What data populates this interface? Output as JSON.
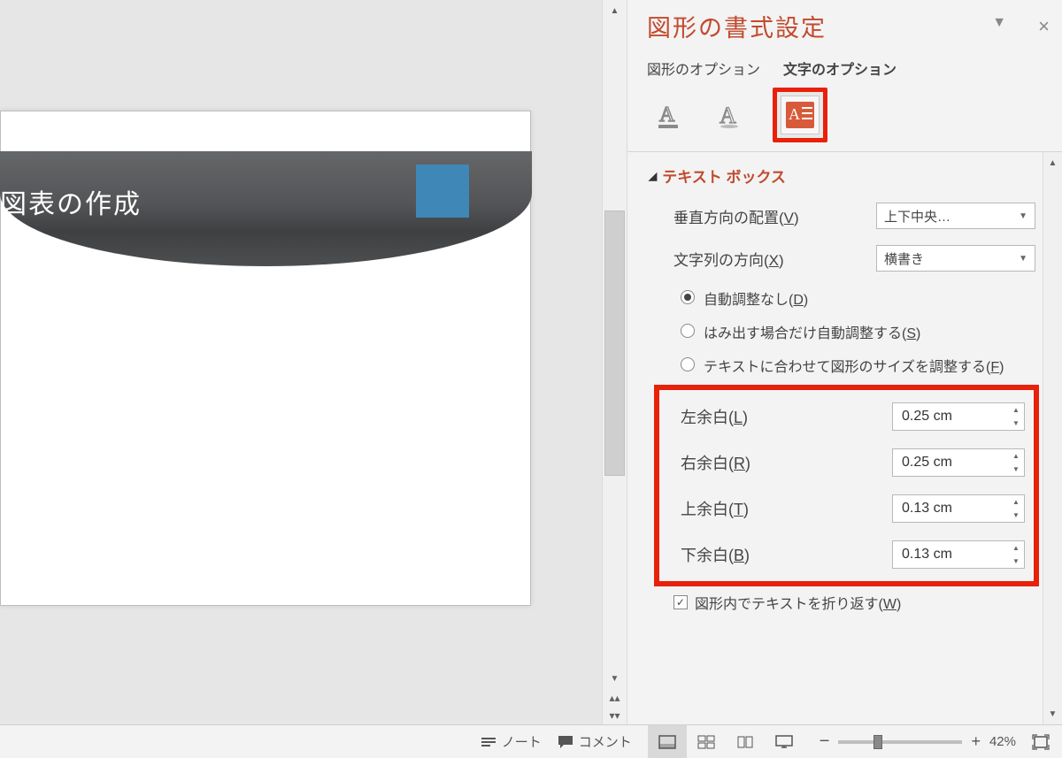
{
  "slide": {
    "title": "図表の作成"
  },
  "panel": {
    "title": "図形の書式設定",
    "tab_shape": "図形のオプション",
    "tab_text": "文字のオプション",
    "section": "テキスト ボックス",
    "valign_label": "垂直方向の配置(",
    "valign_value": "上下中央…",
    "textdir_label": "文字列の方向(",
    "textdir_value": "横書き",
    "radio1": "自動調整なし(",
    "radio2": "はみ出す場合だけ自動調整する(",
    "radio3": "テキストに合わせて図形のサイズを調整する(",
    "m_left": "左余白(",
    "m_left_v": "0.25 cm",
    "m_right": "右余白(",
    "m_right_v": "0.25 cm",
    "m_top": "上余白(",
    "m_top_v": "0.13 cm",
    "m_bot": "下余白(",
    "m_bot_v": "0.13 cm",
    "wrap": "図形内でテキストを折り返す("
  },
  "status": {
    "notes": "ノート",
    "comments": "コメント",
    "zoom": "42%"
  }
}
